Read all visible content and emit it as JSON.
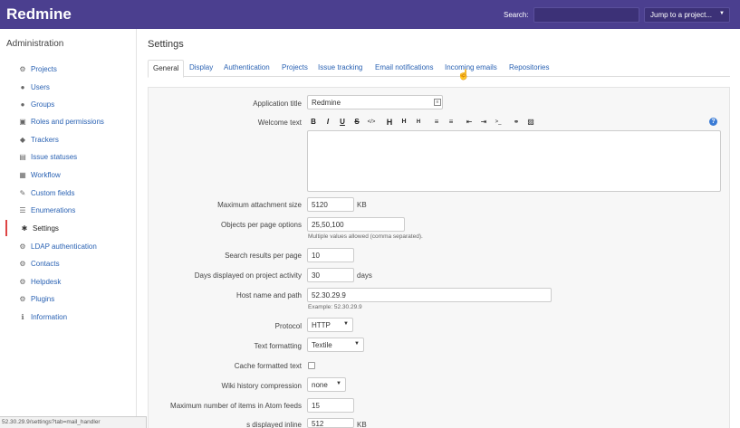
{
  "header": {
    "app_name": "Redmine",
    "search_label": "Search:",
    "jump_label": "Jump to a project...",
    "caret": "▼"
  },
  "sidebar": {
    "title": "Administration",
    "items": [
      {
        "label": "Projects",
        "icon": "⚙"
      },
      {
        "label": "Users",
        "icon": "●"
      },
      {
        "label": "Groups",
        "icon": "●"
      },
      {
        "label": "Roles and permissions",
        "icon": "▣"
      },
      {
        "label": "Trackers",
        "icon": "◆"
      },
      {
        "label": "Issue statuses",
        "icon": "▤"
      },
      {
        "label": "Workflow",
        "icon": "▦"
      },
      {
        "label": "Custom fields",
        "icon": "✎"
      },
      {
        "label": "Enumerations",
        "icon": "☰"
      },
      {
        "label": "Settings",
        "icon": "✱"
      },
      {
        "label": "LDAP authentication",
        "icon": "⚙"
      },
      {
        "label": "Contacts",
        "icon": "⚙"
      },
      {
        "label": "Helpdesk",
        "icon": "⚙"
      },
      {
        "label": "Plugins",
        "icon": "⚙"
      },
      {
        "label": "Information",
        "icon": "ℹ"
      }
    ]
  },
  "main": {
    "title": "Settings",
    "tabs": [
      "General",
      "Display",
      "Authentication",
      "Projects",
      "Issue tracking",
      "Email notifications",
      "Incoming emails",
      "Repositories"
    ]
  },
  "form": {
    "application_title": {
      "label": "Application title",
      "value": "Redmine"
    },
    "welcome_text": {
      "label": "Welcome text"
    },
    "toolbar": [
      "B",
      "I",
      "U",
      "S",
      "</>",
      "H",
      "H",
      "H",
      "≡",
      "≡",
      "⇤",
      "⇥",
      ">_",
      "⚭",
      "▨"
    ],
    "help": "?",
    "max_attachment": {
      "label": "Maximum attachment size",
      "value": "5120",
      "unit": "KB"
    },
    "objects_per_page": {
      "label": "Objects per page options",
      "value": "25,50,100",
      "hint": "Multiple values allowed (comma separated)."
    },
    "search_results": {
      "label": "Search results per page",
      "value": "10"
    },
    "days_displayed": {
      "label": "Days displayed on project activity",
      "value": "30",
      "unit": "days"
    },
    "host_name": {
      "label": "Host name and path",
      "value": "52.30.29.9",
      "hint": "Example: 52.30.29.9"
    },
    "protocol": {
      "label": "Protocol",
      "value": "HTTP"
    },
    "text_formatting": {
      "label": "Text formatting",
      "value": "Textile"
    },
    "cache_formatted": {
      "label": "Cache formatted text"
    },
    "wiki_history": {
      "label": "Wiki history compression",
      "value": "none"
    },
    "max_atom": {
      "label": "Maximum number of items in Atom feeds",
      "value": "15"
    },
    "inline_size": {
      "label": "s displayed inline",
      "value": "512",
      "unit": "KB"
    }
  },
  "status_bar": "52.30.29.9/settings?tab=mail_handler"
}
